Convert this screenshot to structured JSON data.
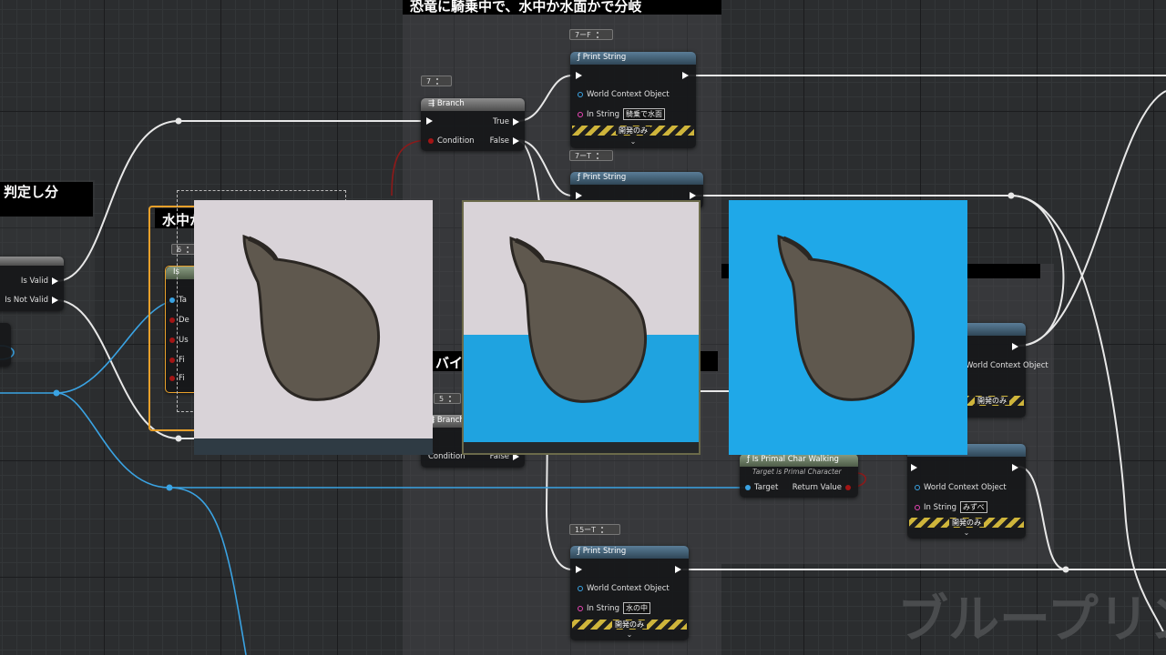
{
  "comments": {
    "top": "恐竜に騎乗中で、水中か水面かで分岐",
    "left": "判定し分",
    "orange": "水中か",
    "mid": "バイバ"
  },
  "reroutes": {
    "r1": "7ーF",
    "r2": "7",
    "r3": "7ーT",
    "r4": "15ーT",
    "r5": "6",
    "r6": "5"
  },
  "is_valid_node": {
    "is_valid": "Is Valid",
    "is_not_valid": "Is Not Valid"
  },
  "branch_top": {
    "title": "Branch",
    "true": "True",
    "false": "False",
    "condition": "Condition"
  },
  "branch_bottom": {
    "title": "Branch",
    "condition": "Condition",
    "false": "False"
  },
  "print_nodes": [
    {
      "title": "Print String",
      "context": "World Context Object",
      "in_string_label": "In String",
      "in_string": "騎乗で水面",
      "dev_only": "開発のみ"
    },
    {
      "title": "Print String"
    },
    {
      "context": "World Context Object",
      "dev_only": "開発のみ"
    },
    {
      "context": "World Context Object",
      "in_string_label": "In String",
      "in_string": "みずべ",
      "dev_only": "開発のみ"
    },
    {
      "title": "Print String",
      "context": "World Context Object",
      "in_string_label": "In String",
      "in_string": "水の中",
      "dev_only": "開発のみ"
    }
  ],
  "walking_node": {
    "title": "Is Primal Char Walking",
    "subtitle": "Target is Primal Character",
    "target": "Target",
    "return_value": "Return Value"
  },
  "orange_node": {
    "title": "Is",
    "pins": [
      "Ta",
      "De",
      "Us",
      "Fi",
      "Fi"
    ]
  },
  "watermark": "ブループリン",
  "thumbnails": [
    {
      "name": "bag-on-plain",
      "bg": "#d9d3d8"
    },
    {
      "name": "bag-half-water",
      "bg": "#d9d3d8",
      "water": "#1fa3e0"
    },
    {
      "name": "bag-underwater",
      "bg": "#1fa8e8"
    }
  ],
  "colors": {
    "exec_wire": "#e8e8e8",
    "object_wire": "#3aa3e3",
    "bool_wire": "#8b1a1a",
    "orange_frame": "#e8a02a"
  }
}
